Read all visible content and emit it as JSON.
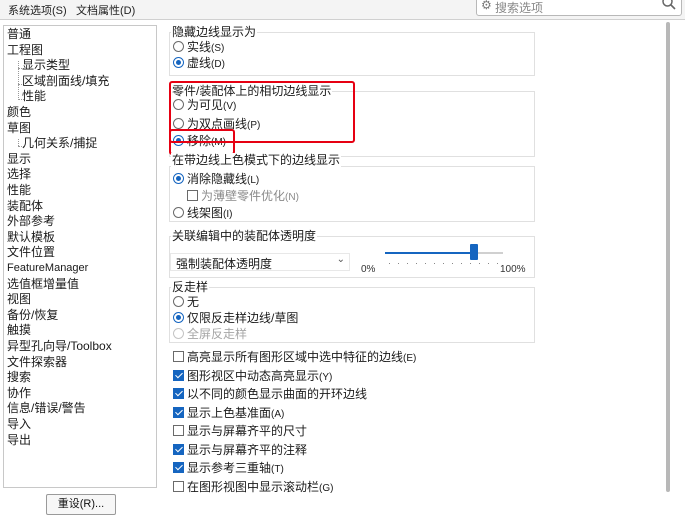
{
  "tabs": [
    "系统选项(S)",
    "文档属性(D)"
  ],
  "search": {
    "placeholder": "搜索选项"
  },
  "sidebar": {
    "items": [
      {
        "label": "普通"
      },
      {
        "label": "工程图"
      },
      {
        "label": "显示类型",
        "sub": true
      },
      {
        "label": "区域剖面线/填充",
        "sub": true
      },
      {
        "label": "性能",
        "sub": true
      },
      {
        "label": "颜色"
      },
      {
        "label": "草图"
      },
      {
        "label": "几何关系/捕捉",
        "sub": true
      },
      {
        "label": "显示"
      },
      {
        "label": "选择"
      },
      {
        "label": "性能"
      },
      {
        "label": "装配体"
      },
      {
        "label": "外部参考"
      },
      {
        "label": "默认模板"
      },
      {
        "label": "文件位置"
      },
      {
        "label": "FeatureManager"
      },
      {
        "label": "选值框增量值"
      },
      {
        "label": "视图"
      },
      {
        "label": "备份/恢复"
      },
      {
        "label": "触摸"
      },
      {
        "label": "异型孔向导/Toolbox"
      },
      {
        "label": "文件探索器"
      },
      {
        "label": "搜索"
      },
      {
        "label": "协作"
      },
      {
        "label": "信息/错误/警告"
      },
      {
        "label": "导入"
      },
      {
        "label": "导出"
      }
    ],
    "reset_label": "重设(R)..."
  },
  "hidden_edges": {
    "title": "隐藏边线显示为",
    "options": [
      {
        "label": "实线",
        "key": "(S)",
        "checked": false
      },
      {
        "label": "虚线",
        "key": "(D)",
        "checked": true
      }
    ]
  },
  "tangent_edges": {
    "title": "零件/装配体上的相切边线显示",
    "options": [
      {
        "label": "为可见",
        "key": "(V)",
        "checked": false
      },
      {
        "label": "为双点画线",
        "key": "(P)",
        "checked": false
      },
      {
        "label": "移除",
        "key": "(M)",
        "checked": true
      }
    ]
  },
  "shaded_edges": {
    "title": "在带边线上色模式下的边线显示",
    "hlr": {
      "label": "消除隐藏线",
      "key": "(L)",
      "checked": true
    },
    "thin_wall": {
      "label": "为薄壁零件优化",
      "key": "(N)",
      "checked": false
    },
    "wireframe": {
      "label": "线架图",
      "key": "(I)",
      "checked": false
    }
  },
  "assembly_transparency": {
    "title": "关联编辑中的装配体透明度",
    "dropdown_value": "强制装配体透明度",
    "min_label": "0%",
    "max_label": "100%",
    "slider_fraction": 0.75
  },
  "antialias": {
    "title": "反走样",
    "options": [
      {
        "label": "无",
        "key": "",
        "checked": false,
        "disabled": false
      },
      {
        "label": "仅限反走样边线/草图",
        "key": "",
        "checked": true,
        "disabled": false
      },
      {
        "label": "全屏反走样",
        "key": "",
        "checked": false,
        "disabled": true
      }
    ]
  },
  "checkboxes": [
    {
      "label": "高亮显示所有图形区域中选中特征的边线",
      "key": "(E)",
      "checked": false
    },
    {
      "label": "图形视区中动态高亮显示",
      "key": "(Y)",
      "checked": true
    },
    {
      "label": "以不同的颜色显示曲面的开环边线",
      "key": "",
      "checked": true
    },
    {
      "label": "显示上色基准面",
      "key": "(A)",
      "checked": true
    },
    {
      "label": "显示与屏幕齐平的尺寸",
      "key": "",
      "checked": false
    },
    {
      "label": "显示与屏幕齐平的注释",
      "key": "",
      "checked": true
    },
    {
      "label": "显示参考三重轴",
      "key": "(T)",
      "checked": true
    },
    {
      "label": "在图形视图中显示滚动栏",
      "key": "(G)",
      "checked": false
    }
  ],
  "colors": {
    "accent": "#1565c0",
    "highlight": "#e60012"
  }
}
